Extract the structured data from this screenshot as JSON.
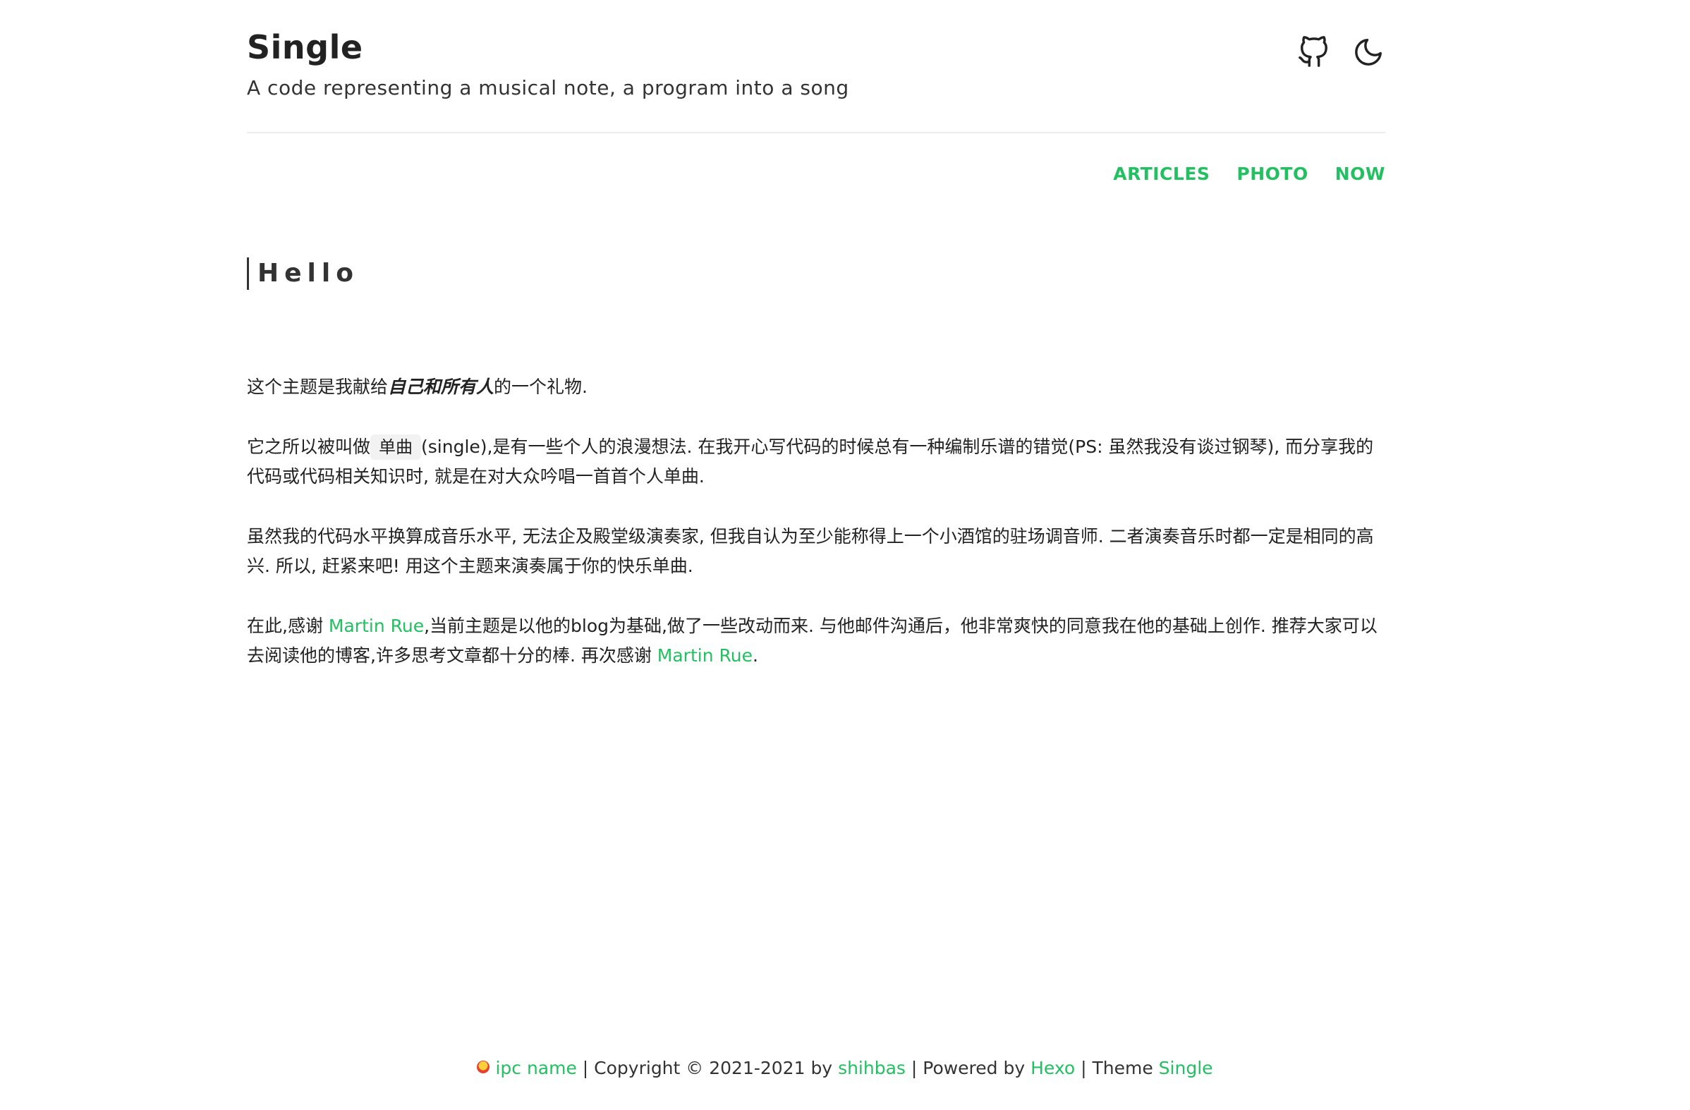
{
  "site": {
    "title": "Single",
    "subtitle": "A code representing a musical note, a program into a song"
  },
  "header": {
    "icons": [
      "github-icon",
      "moon-icon"
    ]
  },
  "nav": {
    "items": [
      "ARTICLES",
      "PHOTO",
      "NOW"
    ]
  },
  "article": {
    "title": "Hello",
    "p1": {
      "before": "这个主题是我献给",
      "emphasis": "自己和所有人",
      "after": "的一个礼物."
    },
    "p2": {
      "before": "它之所以被叫做",
      "code": "单曲",
      "after": "(single),是有一些个人的浪漫想法. 在我开心写代码的时候总有一种编制乐谱的错觉(PS: 虽然我没有谈过钢琴), 而分享我的代码或代码相关知识时, 就是在对大众吟唱一首首个人单曲."
    },
    "p3": "虽然我的代码水平换算成音乐水平, 无法企及殿堂级演奏家, 但我自认为至少能称得上一个小酒馆的驻场调音师. 二者演奏音乐时都一定是相同的高兴. 所以, 赶紧来吧! 用这个主题来演奏属于你的快乐单曲.",
    "p4": {
      "before": "在此,感谢 ",
      "link1": "Martin Rue",
      "middle": ",当前主题是以他的blog为基础,做了一些改动而来. 与他邮件沟通后，他非常爽快的同意我在他的基础上创作. 推荐大家可以去阅读他的博客,许多思考文章都十分的棒. 再次感谢 ",
      "link2": "Martin Rue",
      "end": "."
    }
  },
  "footer": {
    "ipc_link": "ipc name",
    "copyright": " | Copyright © 2021-2021 by ",
    "author_link": "shihbas",
    "powered": " | Powered by ",
    "hexo_link": "Hexo",
    "theme": " | Theme ",
    "theme_link": "Single"
  },
  "colors": {
    "accent": "#22c060",
    "text": "#222222"
  }
}
